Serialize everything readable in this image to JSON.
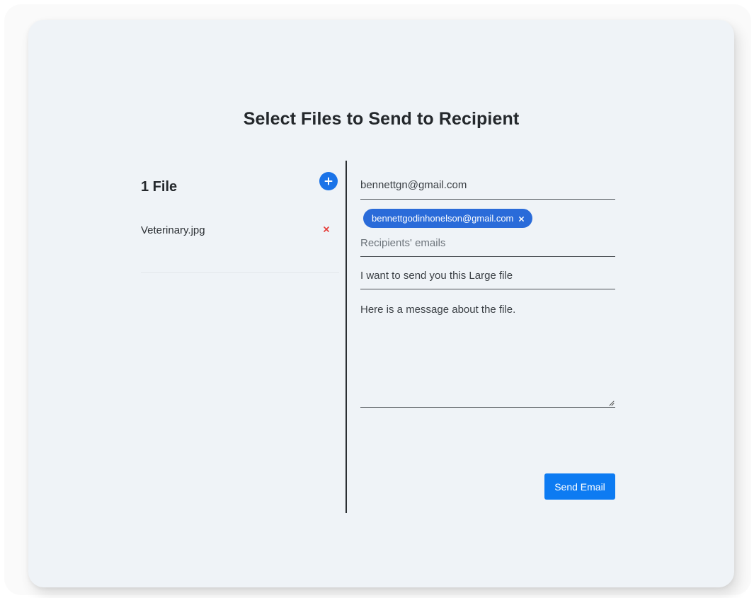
{
  "page": {
    "title": "Select Files to Send to Recipient"
  },
  "files": {
    "count_label": "1 File",
    "items": [
      {
        "name": "Veterinary.jpg"
      }
    ]
  },
  "form": {
    "sender_email": "bennettgn@gmail.com",
    "recipients": [
      {
        "email": "bennettgodinhonelson@gmail.com"
      }
    ],
    "recipients_placeholder": "Recipients' emails",
    "subject": "I want to send you this Large file",
    "message": "Here is a message about the file.",
    "send_label": "Send Email"
  },
  "colors": {
    "card_background": "#eff3f7",
    "accent": "#0d7bf2",
    "chip": "#2a6bd9",
    "remove": "#e53935"
  },
  "icons": {
    "add": "plus-icon",
    "remove_file": "close-icon",
    "remove_chip": "close-icon"
  }
}
